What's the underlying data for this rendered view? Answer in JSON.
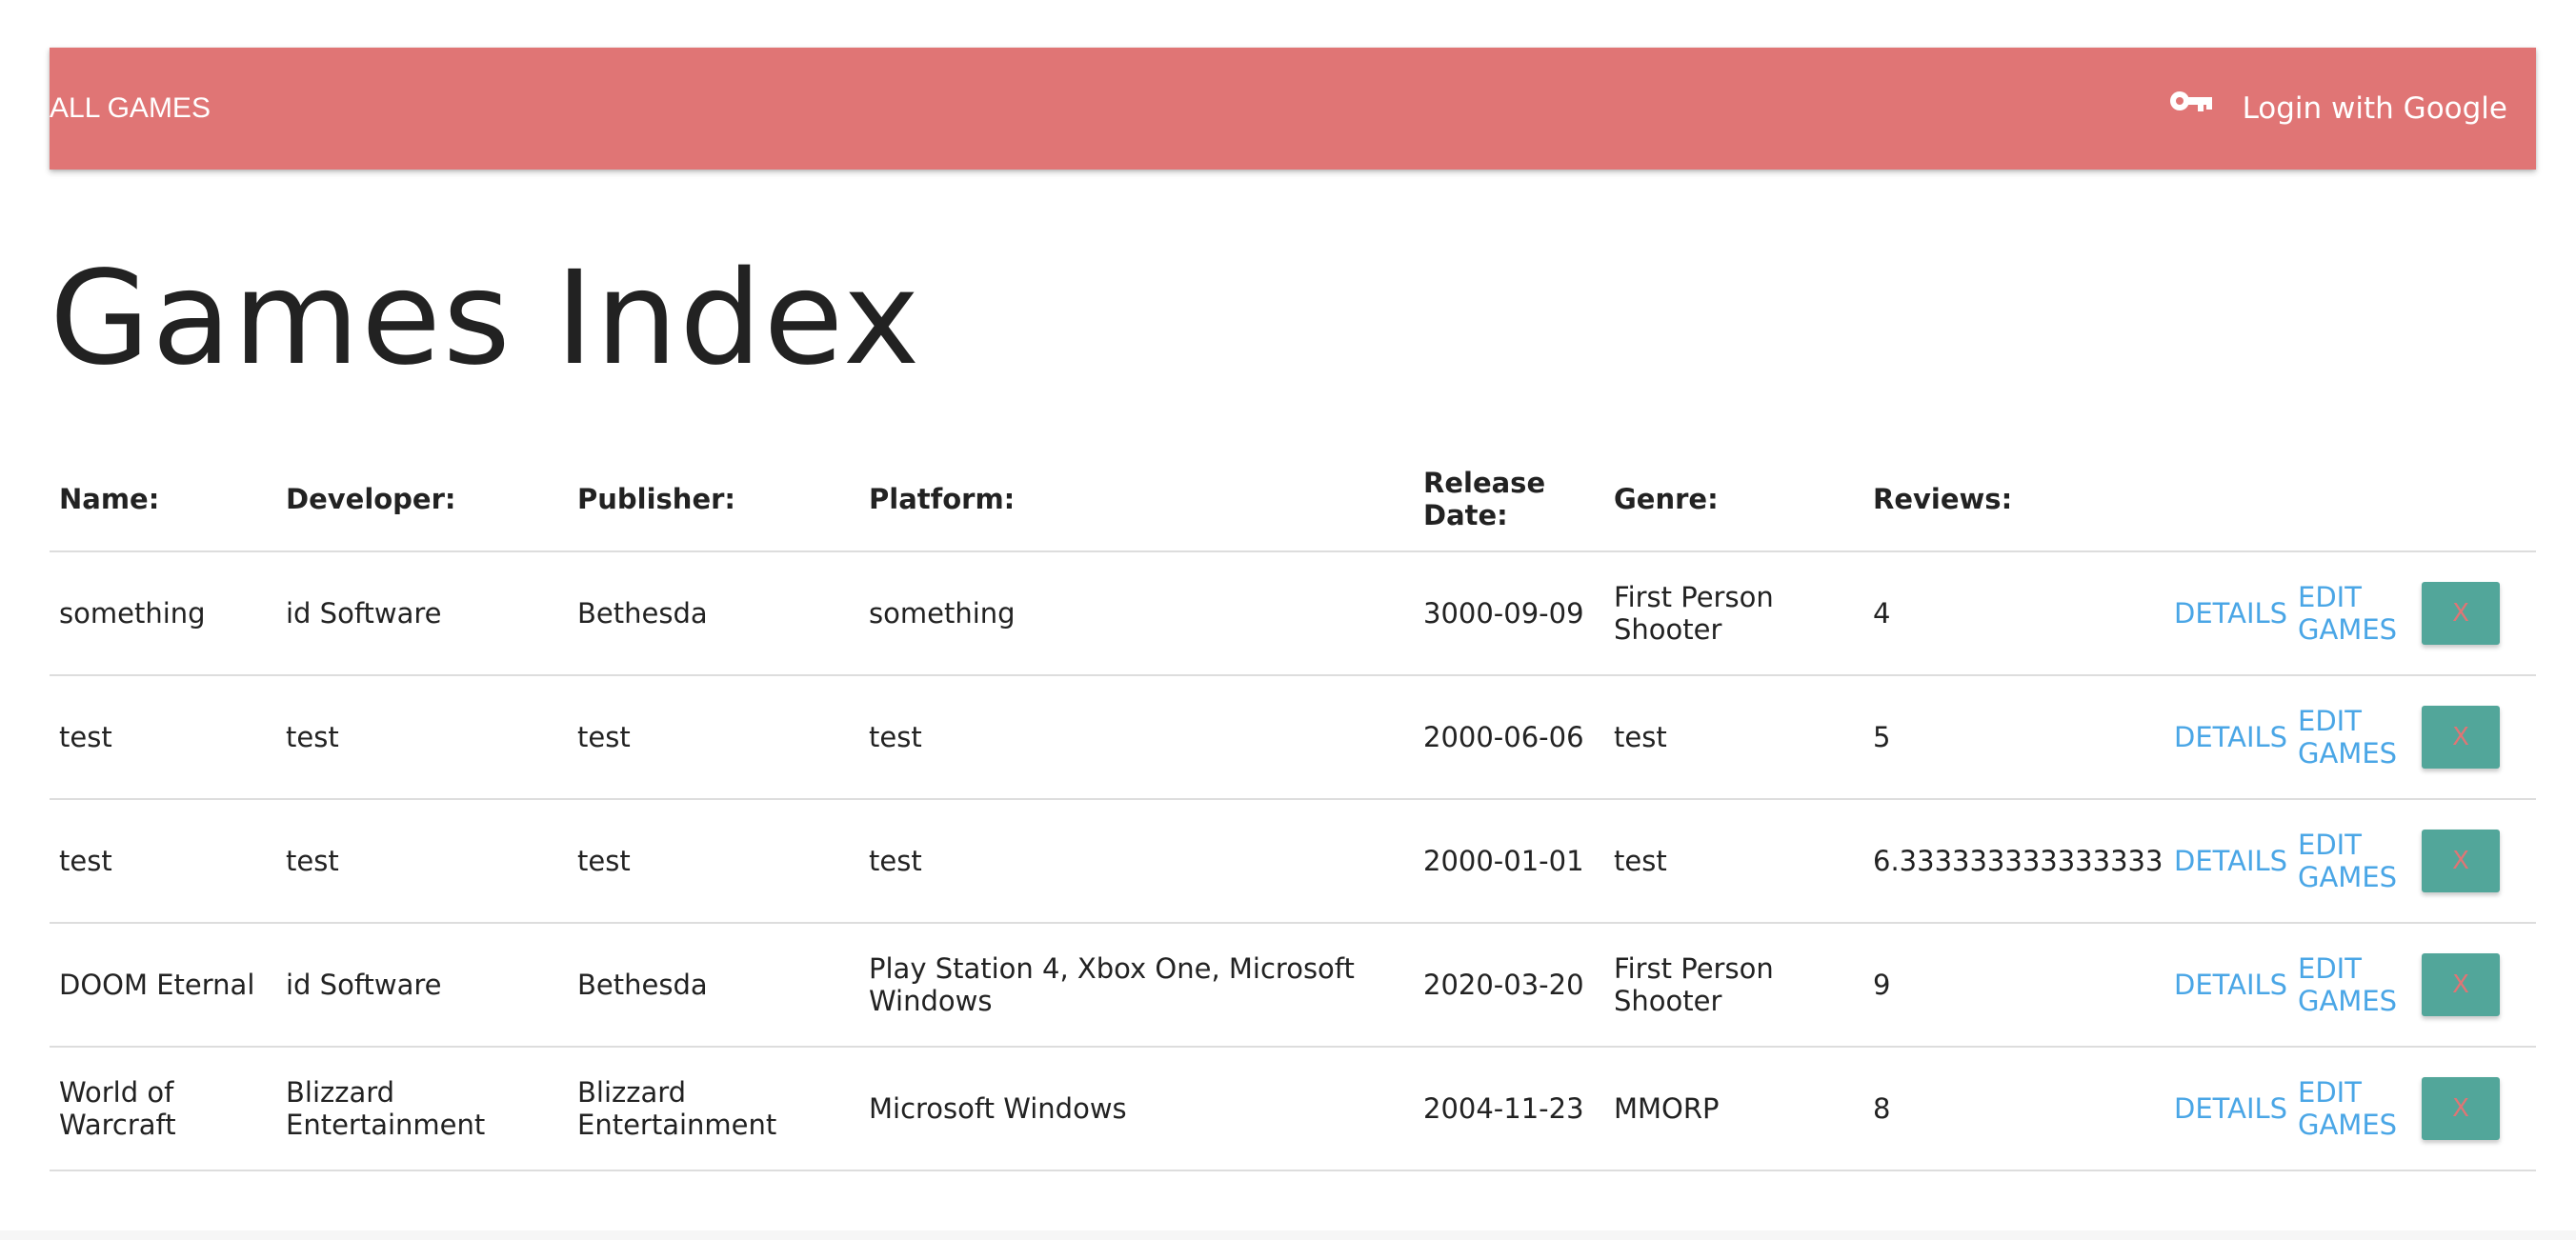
{
  "nav": {
    "brand": "ALL GAMES",
    "login_icon": "key-icon",
    "login_label": "Login with Google",
    "bar_color": "#e07575"
  },
  "page": {
    "title": "Games Index"
  },
  "table": {
    "headers": {
      "name": "Name:",
      "developer": "Developer:",
      "publisher": "Publisher:",
      "platform": "Platform:",
      "release_date": "Release Date:",
      "genre": "Genre:",
      "reviews": "Reviews:"
    },
    "actions": {
      "details_label": "DETAILS",
      "edit_label": "EDIT GAMES",
      "delete_label": "X",
      "delete_color": "#52a69a",
      "link_color": "#4aa6e6"
    },
    "rows": [
      {
        "name": "something",
        "developer": "id Software",
        "publisher": "Bethesda",
        "platform": "something",
        "release_date": "3000-09-09",
        "genre": "First Person Shooter",
        "reviews": "4"
      },
      {
        "name": "test",
        "developer": "test",
        "publisher": "test",
        "platform": "test",
        "release_date": "2000-06-06",
        "genre": "test",
        "reviews": "5"
      },
      {
        "name": "test",
        "developer": "test",
        "publisher": "test",
        "platform": "test",
        "release_date": "2000-01-01",
        "genre": "test",
        "reviews": "6.333333333333333"
      },
      {
        "name": "DOOM Eternal",
        "developer": "id Software",
        "publisher": "Bethesda",
        "platform": "Play Station 4, Xbox One, Microsoft Windows",
        "release_date": "2020-03-20",
        "genre": "First Person Shooter",
        "reviews": "9"
      },
      {
        "name": "World of Warcraft",
        "developer": "Blizzard Entertainment",
        "publisher": "Blizzard Entertainment",
        "platform": "Microsoft Windows",
        "release_date": "2004-11-23",
        "genre": "MMORP",
        "reviews": "8"
      }
    ]
  }
}
